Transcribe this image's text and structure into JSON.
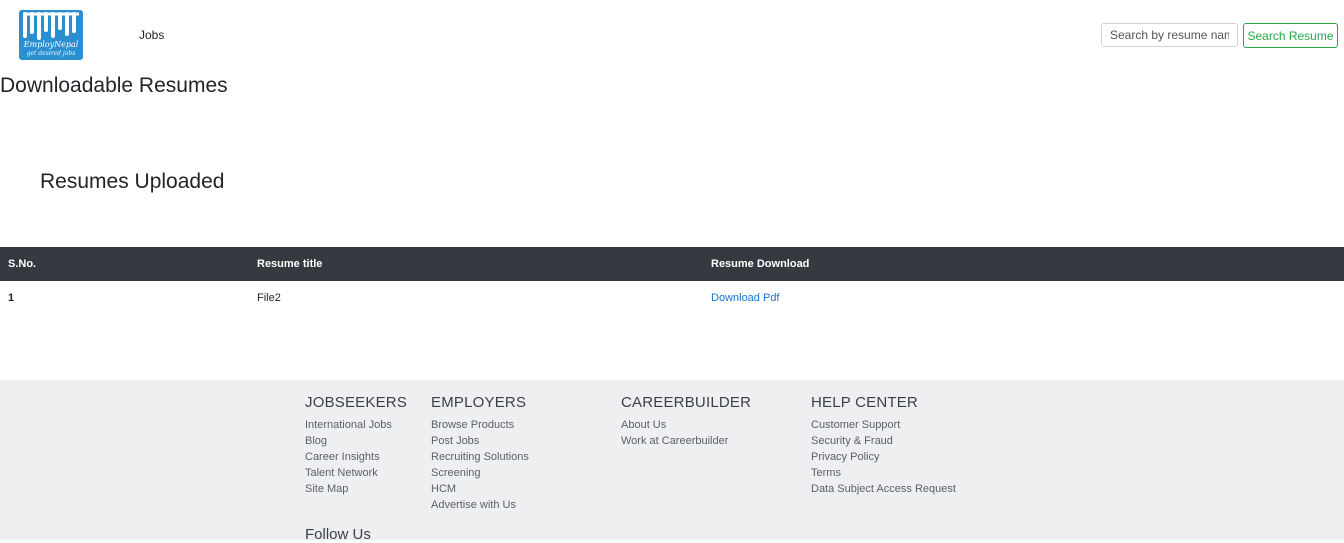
{
  "header": {
    "logo": {
      "brand": "EmployNepal",
      "tagline": "get desired jobs"
    },
    "nav_jobs": "Jobs",
    "search_placeholder": "Search by resume name",
    "search_button": "Search Resume"
  },
  "page_title": "Downloadable Resumes",
  "section_title": "Resumes Uploaded",
  "table": {
    "headers": [
      "S.No.",
      "Resume title",
      "Resume Download"
    ],
    "rows": [
      {
        "sno": "1",
        "title": "File2",
        "download": "Download Pdf"
      }
    ]
  },
  "footer": {
    "columns": [
      {
        "heading": "JOBSEEKERS",
        "links": [
          "International Jobs",
          "Blog",
          "Career Insights",
          "Talent Network",
          "Site Map"
        ]
      },
      {
        "heading": "EMPLOYERS",
        "links": [
          "Browse Products",
          "Post Jobs",
          "Recruiting Solutions",
          "Screening",
          "HCM",
          "Advertise with Us"
        ]
      },
      {
        "heading": "CAREERBUILDER",
        "links": [
          "About Us",
          "Work at Careerbuilder"
        ]
      },
      {
        "heading": "HELP CENTER",
        "links": [
          "Customer Support",
          "Security & Fraud",
          "Privacy Policy",
          "Terms",
          "Data Subject Access Request"
        ]
      }
    ],
    "follow_us": "Follow Us"
  },
  "colors": {
    "brand_blue": "#2a8fcf",
    "table_header_bg": "#343a40",
    "search_green": "#28a745",
    "link_blue": "#1a73c9",
    "footer_bg": "#eeeff1"
  }
}
